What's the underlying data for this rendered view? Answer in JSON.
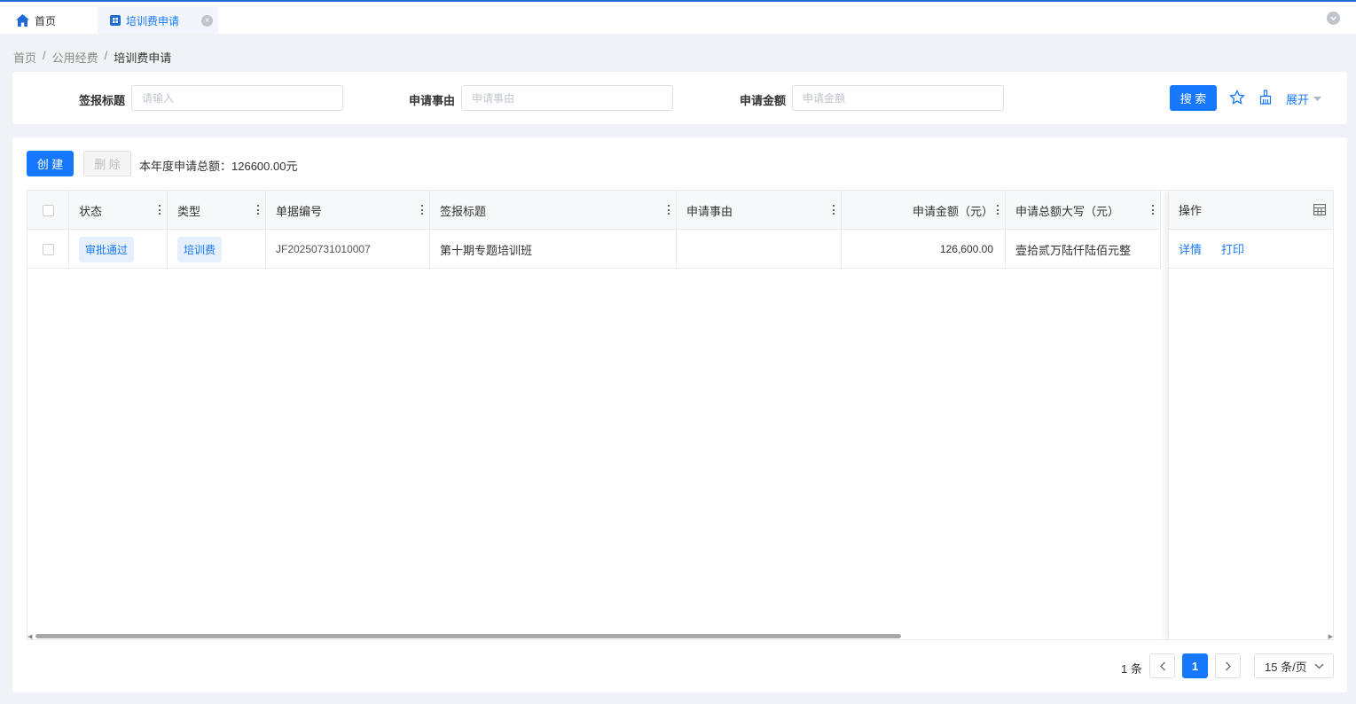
{
  "tabs": [
    {
      "label": "首页",
      "icon": "home-icon"
    },
    {
      "label": "培训费申请",
      "icon": "grid-app-icon"
    }
  ],
  "breadcrumb": [
    "首页",
    "公用经费",
    "培训费申请"
  ],
  "search": {
    "fields": [
      {
        "label": "签报标题",
        "placeholder": "请输入",
        "value": ""
      },
      {
        "label": "申请事由",
        "placeholder": "申请事由",
        "value": ""
      },
      {
        "label": "申请金额",
        "placeholder": "申请金额",
        "value": ""
      }
    ],
    "search_button": "搜 索",
    "expand_label": "展开"
  },
  "toolbar": {
    "create_label": "创 建",
    "delete_label": "删 除",
    "summary": "本年度申请总额：126600.00元"
  },
  "table": {
    "columns": [
      "状态",
      "类型",
      "单据编号",
      "签报标题",
      "申请事由",
      "申请金额（元）",
      "申请总额大写（元）",
      "操作"
    ],
    "rows": [
      {
        "status": "审批通过",
        "type": "培训费",
        "doc_no": "JF20250731010007",
        "title": "第十期专题培训班",
        "reason": "",
        "amount": "126,600.00",
        "amount_upper": "壹拾贰万陆仟陆佰元整",
        "actions": [
          "详情",
          "打印"
        ]
      }
    ]
  },
  "pagination": {
    "total": "1 条",
    "current_page": "1",
    "page_size": "15 条/页"
  },
  "colors": {
    "primary": "#1677ff",
    "tag_bg": "#e6f0fd"
  }
}
